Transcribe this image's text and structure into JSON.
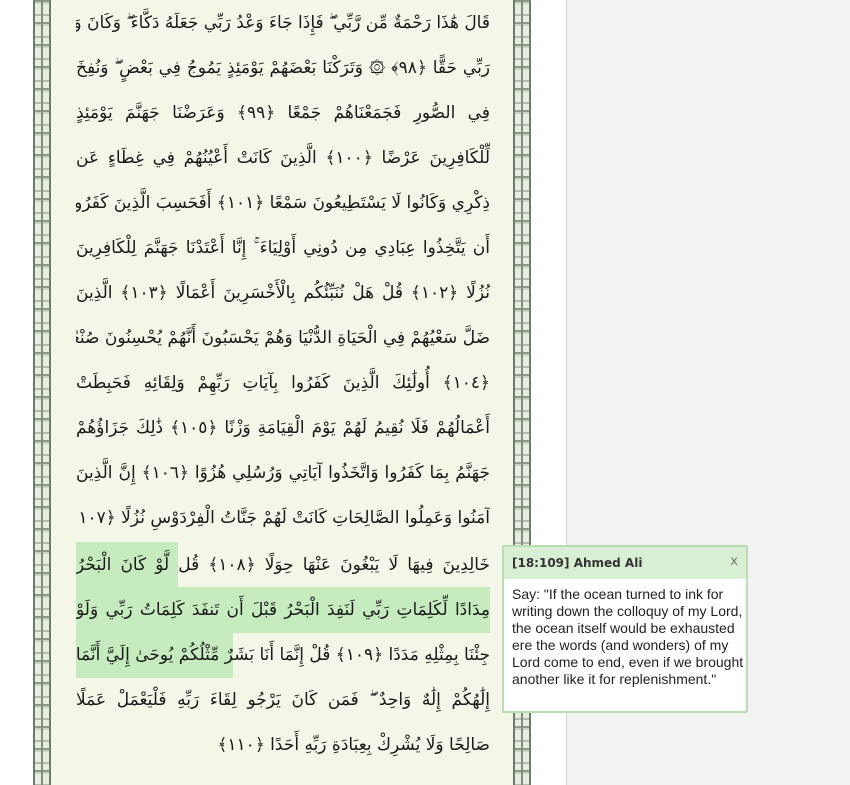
{
  "quran_page": {
    "lines": [
      "قَالَ هَٰذَا رَحْمَةٌ مِّن رَّبِّي ۖ فَإِذَا جَاءَ وَعْدُ رَبِّي جَعَلَهُ دَكَّاءَ ۖ وَكَانَ وَعْدُ",
      "رَبِّي حَقًّا ﴿٩٨﴾ ۞ وَتَرَكْنَا بَعْضَهُمْ يَوْمَئِذٍ يَمُوجُ فِي بَعْضٍ ۖ وَنُفِخَ",
      "فِي الصُّورِ فَجَمَعْنَاهُمْ جَمْعًا ﴿٩٩﴾ وَعَرَضْنَا جَهَنَّمَ يَوْمَئِذٍ",
      "لِّلْكَافِرِينَ عَرْضًا ﴿١٠٠﴾ الَّذِينَ كَانَتْ أَعْيُنُهُمْ فِي غِطَاءٍ عَن",
      "ذِكْرِي وَكَانُوا لَا يَسْتَطِيعُونَ سَمْعًا ﴿١٠١﴾ أَفَحَسِبَ الَّذِينَ كَفَرُوا",
      "أَن يَتَّخِذُوا عِبَادِي مِن دُونِي أَوْلِيَاءَ ۚ إِنَّا أَعْتَدْنَا جَهَنَّمَ لِلْكَافِرِينَ",
      "نُزُلًا ﴿١٠٢﴾ قُلْ هَلْ نُنَبِّئُكُم بِالْأَخْسَرِينَ أَعْمَالًا ﴿١٠٣﴾ الَّذِينَ",
      "ضَلَّ سَعْيُهُمْ فِي الْحَيَاةِ الدُّنْيَا وَهُمْ يَحْسَبُونَ أَنَّهُمْ يُحْسِنُونَ صُنْعًا",
      "﴿١٠٤﴾ أُولَٰئِكَ الَّذِينَ كَفَرُوا بِآيَاتِ رَبِّهِمْ وَلِقَائِهِ فَحَبِطَتْ",
      "أَعْمَالُهُمْ فَلَا نُقِيمُ لَهُمْ يَوْمَ الْقِيَامَةِ وَزْنًا ﴿١٠٥﴾ ذَٰلِكَ جَزَاؤُهُمْ",
      "جَهَنَّمُ بِمَا كَفَرُوا وَاتَّخَذُوا آيَاتِي وَرُسُلِي هُزُوًا ﴿١٠٦﴾ إِنَّ الَّذِينَ",
      "آمَنُوا وَعَمِلُوا الصَّالِحَاتِ كَانَتْ لَهُمْ جَنَّاتُ الْفِرْدَوْسِ نُزُلًا ﴿١٠٧﴾",
      "خَالِدِينَ فِيهَا لَا يَبْغُونَ عَنْهَا حِوَلًا ﴿١٠٨﴾ قُل لَّوْ كَانَ الْبَحْرُ",
      "مِدَادًا لِّكَلِمَاتِ رَبِّي لَنَفِدَ الْبَحْرُ قَبْلَ أَن تَنفَدَ كَلِمَاتُ رَبِّي وَلَوْ",
      "جِئْنَا بِمِثْلِهِ مَدَدًا ﴿١٠٩﴾ قُلْ إِنَّمَا أَنَا بَشَرٌ مِّثْلُكُمْ يُوحَىٰ إِلَيَّ أَنَّمَا",
      "إِلَٰهُكُمْ إِلَٰهٌ وَاحِدٌ ۖ فَمَن كَانَ يَرْجُو لِقَاءَ رَبِّهِ فَلْيَعْمَلْ عَمَلًا",
      "صَالِحًا وَلَا يُشْرِكْ بِعِبَادَةِ رَبِّهِ أَحَدًا ﴿١١٠﴾"
    ]
  },
  "translation_popup": {
    "title": "[18:109] Ahmed Ali",
    "close_label": "x",
    "text": "Say: \"If the ocean turned to ink for writing down the colloquy of my Lord, the ocean itself would be exhausted ere the words (and wonders) of my Lord come to end, even if we brought another like it for replenishment.\""
  },
  "colors": {
    "highlight": "#c6ebbf",
    "page_background": "#f4f7e8",
    "popup_border": "#b9dcb1"
  }
}
